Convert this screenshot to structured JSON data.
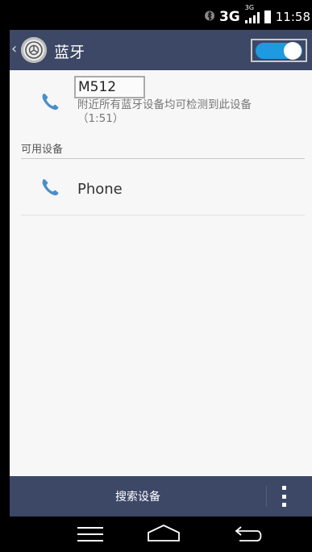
{
  "statusbar": {
    "network": "3G",
    "network_small": "3G",
    "time": "11:58"
  },
  "header": {
    "back_label": "‹",
    "title": "蓝牙",
    "toggle_state": "on"
  },
  "device": {
    "name": "M512",
    "subtitle": "附近所有蓝牙设备均可检测到此设备（1:51）",
    "icon": "phone-icon"
  },
  "available_section": {
    "label": "可用设备",
    "items": [
      {
        "name": "Phone",
        "icon": "phone-icon"
      }
    ]
  },
  "bottom": {
    "search_label": "搜索设备",
    "more_icon": "more-icon"
  },
  "navigation": [
    "recent-apps-icon",
    "home-icon",
    "back-icon"
  ],
  "colors": {
    "header_bg": "#3d4867",
    "accent": "#1e9be0",
    "phone_icon": "#4a8ec9"
  }
}
